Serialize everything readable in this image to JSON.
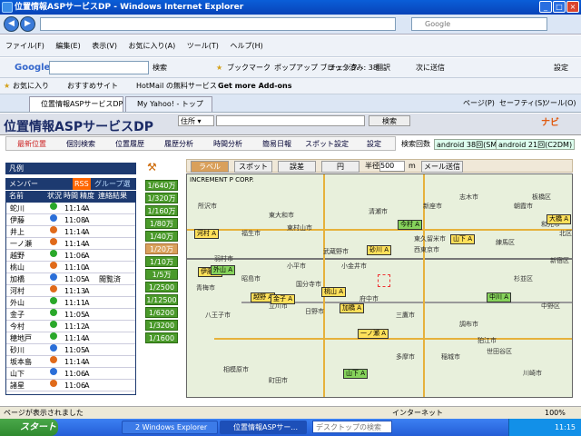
{
  "browser": {
    "title": "位置情報ASPサービスDP - Windows Internet Explorer",
    "search_placeholder": "Google",
    "menu": [
      "ファイル(F)",
      "編集(E)",
      "表示(V)",
      "お気に入り(A)",
      "ツール(T)",
      "ヘルプ(H)"
    ],
    "google_toolbar": {
      "logo": "Google",
      "search_label": "検索",
      "bookmark": "ブックマーク",
      "popup": "ポップアップ ブロック済み: 38",
      "check": "チェック",
      "translate": "翻訳",
      "send": "次に送信",
      "settings": "設定"
    },
    "favorites": {
      "fav_label": "お気に入り",
      "items": [
        "おすすめサイト",
        "HotMail の無料サービス",
        "Get more Add-ons"
      ]
    },
    "tabs": [
      "位置情報ASPサービスDP",
      "My Yahoo! - トップ"
    ],
    "cmdbar": [
      "ページ(P)",
      "セーフティ(S)",
      "ツール(O)"
    ]
  },
  "app": {
    "title": "位置情報ASPサービスDP",
    "address_type": "住所",
    "search_button": "検索",
    "nav": [
      "最新位置",
      "個別検索",
      "位置履歴",
      "履歴分析",
      "時間分析",
      "簡易日報",
      "スポット設定",
      "設定"
    ],
    "count_label": "検索回数",
    "count_sms": "android 38回(SMS)",
    "count_c2dm": "android 21回(C2DM)",
    "legend_label": "凡例",
    "member_label": "メンバー",
    "rss": "RSS",
    "group_select": "グループ選択",
    "columns": [
      "名前",
      "状況",
      "時間",
      "精度",
      "連絡結果"
    ],
    "rows": [
      {
        "name": "蛇川",
        "time": "11:14",
        "acc": "A",
        "result": "",
        "color": "#2aa82a"
      },
      {
        "name": "伊藤",
        "time": "11:08",
        "acc": "A",
        "result": "",
        "color": "#2b6fd8"
      },
      {
        "name": "井上",
        "time": "11:14",
        "acc": "A",
        "result": "",
        "color": "#e06a1a"
      },
      {
        "name": "一ノ瀬",
        "time": "11:14",
        "acc": "A",
        "result": "",
        "color": "#e06a1a"
      },
      {
        "name": "越野",
        "time": "11:06",
        "acc": "A",
        "result": "",
        "color": "#2aa82a"
      },
      {
        "name": "桃山",
        "time": "11:10",
        "acc": "A",
        "result": "",
        "color": "#e06a1a"
      },
      {
        "name": "加橋",
        "time": "11:05",
        "acc": "A",
        "result": "閲覧済",
        "color": "#2b6fd8"
      },
      {
        "name": "河村",
        "time": "11:13",
        "acc": "A",
        "result": "",
        "color": "#e06a1a"
      },
      {
        "name": "外山",
        "time": "11:11",
        "acc": "A",
        "result": "",
        "color": "#2aa82a"
      },
      {
        "name": "金子",
        "time": "11:05",
        "acc": "A",
        "result": "",
        "color": "#2aa82a"
      },
      {
        "name": "今村",
        "time": "11:12",
        "acc": "A",
        "result": "",
        "color": "#2aa82a"
      },
      {
        "name": "穂地戸",
        "time": "11:14",
        "acc": "A",
        "result": "",
        "color": "#2aa82a"
      },
      {
        "name": "砂川",
        "time": "11:05",
        "acc": "A",
        "result": "",
        "color": "#2b6fd8"
      },
      {
        "name": "坂本島",
        "time": "11:14",
        "acc": "A",
        "result": "",
        "color": "#e06a1a"
      },
      {
        "name": "山下",
        "time": "11:06",
        "acc": "A",
        "result": "",
        "color": "#2b6fd8"
      },
      {
        "name": "諸星",
        "time": "11:06",
        "acc": "A",
        "result": "",
        "color": "#e06a1a"
      }
    ],
    "zoom": [
      "1/640万",
      "1/320万",
      "1/160万",
      "1/80万",
      "1/40万",
      "1/20万",
      "1/10万",
      "1/5万",
      "1/2500",
      "1/12500",
      "1/6200",
      "1/3200",
      "1/1600"
    ],
    "zoom_selected": "1/20万",
    "map_toolbar": {
      "label": "ラベル",
      "spot": "スポット",
      "error": "誤差",
      "circle": "円",
      "radius_label": "半径",
      "radius_value": "500",
      "radius_unit": "m",
      "mail": "メール送信"
    },
    "map_copyright": "INCREMENT P CORP.",
    "map_labels": [
      {
        "text": "今村 A",
        "g": true
      },
      {
        "text": "山下 A",
        "g": false
      },
      {
        "text": "大橋 A",
        "g": false
      },
      {
        "text": "河村 A",
        "g": false
      },
      {
        "text": "砂川 A",
        "g": false
      },
      {
        "text": "伊藤 A",
        "g": false
      },
      {
        "text": "外山 A",
        "g": true
      },
      {
        "text": "越野 A",
        "g": false
      },
      {
        "text": "金子 A",
        "g": false
      },
      {
        "text": "加橋 A",
        "g": false
      },
      {
        "text": "一ノ瀬 A",
        "g": false
      },
      {
        "text": "中川 A",
        "g": true
      },
      {
        "text": "桃山 A",
        "g": false
      },
      {
        "text": "山下 A",
        "g": true
      }
    ],
    "map_places": [
      "所沢市",
      "清瀬市",
      "東村山市",
      "東久留米市",
      "西東京市",
      "武蔵野市",
      "小金井市",
      "小平市",
      "国分寺市",
      "立川市",
      "府中市",
      "日野市",
      "八王子市",
      "多摩市",
      "稲城市",
      "調布市",
      "三鷹市",
      "練馬区",
      "杉並区",
      "中野区",
      "新宿区",
      "世田谷区",
      "川崎市",
      "町田市",
      "福生市",
      "羽村市",
      "昭島市",
      "相模原市",
      "狛江市",
      "東大和市",
      "青梅市",
      "志木市",
      "新座市",
      "朝霞市",
      "和光市",
      "板橋区",
      "北区"
    ]
  },
  "status": {
    "text": "ページが表示されました",
    "zone": "インターネット",
    "zoom": "100%"
  },
  "taskbar": {
    "start": "スタート",
    "tasks": [
      "2 Windows Explorer",
      "位置情報ASPサー..."
    ],
    "desk_search": "デスクトップの検索",
    "time": "11:15"
  }
}
